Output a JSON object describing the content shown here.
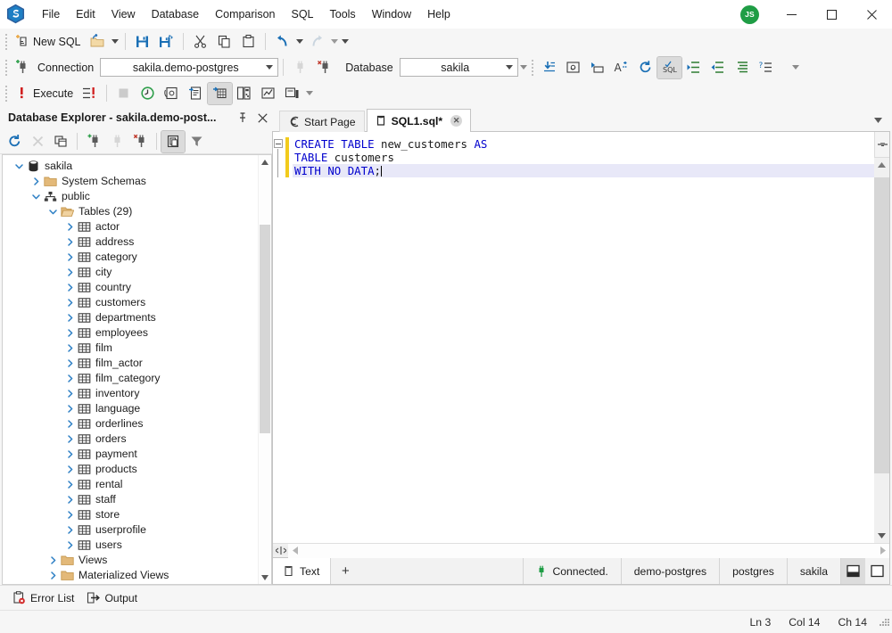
{
  "app": {
    "logo_icon": "sqlmanager-hex-logo",
    "menu": [
      "File",
      "Edit",
      "View",
      "Database",
      "Comparison",
      "SQL",
      "Tools",
      "Window",
      "Help"
    ],
    "avatar_initials": "JS",
    "window_controls": {
      "minimize": "minimize-icon",
      "maximize": "maximize-icon",
      "close": "close-icon"
    }
  },
  "toolbar_main": {
    "new_sql_label": "New SQL",
    "items": [
      {
        "name": "new-sql-button",
        "icon": "new-sql-icon"
      },
      {
        "name": "open-file-button",
        "icon": "open-folder-icon"
      },
      {
        "name": "open-file-dropdown",
        "icon": "chevron-down-icon"
      },
      {
        "name": "save-button",
        "icon": "save-disk-icon"
      },
      {
        "name": "save-all-button",
        "icon": "save-all-icon"
      },
      {
        "name": "cut-button",
        "icon": "scissors-icon"
      },
      {
        "name": "copy-button",
        "icon": "copy-icon"
      },
      {
        "name": "paste-button",
        "icon": "paste-icon"
      },
      {
        "name": "undo-button",
        "icon": "undo-arrow-icon"
      },
      {
        "name": "undo-dropdown",
        "icon": "chevron-down-icon"
      },
      {
        "name": "redo-button",
        "icon": "redo-arrow-icon"
      },
      {
        "name": "redo-dropdown",
        "icon": "chevron-down-icon"
      },
      {
        "name": "toolbar-overflow",
        "icon": "chevron-down-icon"
      }
    ]
  },
  "toolbar_connection": {
    "connect_icon": "connect-plug-icon",
    "connection_label": "Connection",
    "connection_value": "sakila.demo-postgres",
    "disconnect_icon": "plug-grey-icon",
    "disconnect_all_icon": "plug-disconnect-icon",
    "database_label": "Database",
    "database_value": "sakila",
    "overflow_icon": "chevron-down-icon",
    "right_icons": [
      {
        "name": "execute-to-file-button",
        "icon": "insert-down-icon"
      },
      {
        "name": "email-results-button",
        "icon": "at-sign-icon"
      },
      {
        "name": "rename-button",
        "icon": "rename-icon"
      },
      {
        "name": "format-case-button",
        "icon": "letter-a-icon"
      },
      {
        "name": "refresh-button",
        "icon": "refresh-circular-icon"
      },
      {
        "name": "format-sql-button",
        "icon": "sql-check-icon"
      },
      {
        "name": "outdent-button",
        "icon": "outdent-icon"
      },
      {
        "name": "indent-button",
        "icon": "indent-icon"
      },
      {
        "name": "comment-button",
        "icon": "comment-lines-icon"
      },
      {
        "name": "help-sql-button",
        "icon": "question-lines-icon"
      },
      {
        "name": "toolbar-overflow-2",
        "icon": "chevron-down-icon"
      }
    ]
  },
  "toolbar_execute": {
    "execute_label": "Execute",
    "items": [
      {
        "name": "execute-button",
        "icon": "exclamation-red-icon"
      },
      {
        "name": "execute-batch-button",
        "icon": "execute-list-icon"
      },
      {
        "name": "stop-button",
        "icon": "stop-square-icon"
      },
      {
        "name": "execution-plan-button",
        "icon": "clock-green-icon"
      },
      {
        "name": "execute-to-editor-button",
        "icon": "at-page-icon"
      },
      {
        "name": "results-to-text-button",
        "icon": "results-text-icon"
      },
      {
        "name": "results-to-grid-button",
        "icon": "results-grid-icon"
      },
      {
        "name": "results-to-file-button",
        "icon": "results-file-icon"
      },
      {
        "name": "results-to-chart-button",
        "icon": "chart-icon"
      },
      {
        "name": "results-window-button",
        "icon": "results-window-icon"
      },
      {
        "name": "execute-overflow",
        "icon": "chevron-down-icon"
      }
    ]
  },
  "explorer": {
    "title": "Database Explorer - sakila.demo-post...",
    "pin_icon": "pin-icon",
    "close_icon": "close-icon",
    "toolbar": [
      {
        "name": "refresh-button",
        "icon": "refresh-blue-icon"
      },
      {
        "name": "delete-button",
        "icon": "x-grey-icon"
      },
      {
        "name": "duplicate-button",
        "icon": "copy-window-icon"
      },
      {
        "name": "new-connection-button",
        "icon": "plug-add-icon"
      },
      {
        "name": "connect-button",
        "icon": "plug-grey-icon"
      },
      {
        "name": "disconnect-button",
        "icon": "plug-disconnect-icon"
      },
      {
        "name": "copy-object-button",
        "icon": "copy-page-icon"
      },
      {
        "name": "filter-button",
        "icon": "funnel-icon"
      }
    ],
    "tree": [
      {
        "label": "sakila",
        "depth": 0,
        "icon": "database-icon",
        "expander": "down",
        "expanded": true
      },
      {
        "label": "System Schemas",
        "depth": 1,
        "icon": "folder-icon",
        "expander": "right",
        "expanded": false
      },
      {
        "label": "public",
        "depth": 1,
        "icon": "schema-icon",
        "expander": "down",
        "expanded": true
      },
      {
        "label": "Tables (29)",
        "depth": 2,
        "icon": "folder-open-icon",
        "expander": "down",
        "expanded": true
      },
      {
        "label": "actor",
        "depth": 3,
        "icon": "table-icon",
        "expander": "right",
        "expanded": false
      },
      {
        "label": "address",
        "depth": 3,
        "icon": "table-icon",
        "expander": "right",
        "expanded": false
      },
      {
        "label": "category",
        "depth": 3,
        "icon": "table-icon",
        "expander": "right",
        "expanded": false
      },
      {
        "label": "city",
        "depth": 3,
        "icon": "table-icon",
        "expander": "right",
        "expanded": false
      },
      {
        "label": "country",
        "depth": 3,
        "icon": "table-icon",
        "expander": "right",
        "expanded": false
      },
      {
        "label": "customers",
        "depth": 3,
        "icon": "table-icon",
        "expander": "right",
        "expanded": false
      },
      {
        "label": "departments",
        "depth": 3,
        "icon": "table-icon",
        "expander": "right",
        "expanded": false
      },
      {
        "label": "employees",
        "depth": 3,
        "icon": "table-icon",
        "expander": "right",
        "expanded": false
      },
      {
        "label": "film",
        "depth": 3,
        "icon": "table-icon",
        "expander": "right",
        "expanded": false
      },
      {
        "label": "film_actor",
        "depth": 3,
        "icon": "table-icon",
        "expander": "right",
        "expanded": false
      },
      {
        "label": "film_category",
        "depth": 3,
        "icon": "table-icon",
        "expander": "right",
        "expanded": false
      },
      {
        "label": "inventory",
        "depth": 3,
        "icon": "table-icon",
        "expander": "right",
        "expanded": false
      },
      {
        "label": "language",
        "depth": 3,
        "icon": "table-icon",
        "expander": "right",
        "expanded": false
      },
      {
        "label": "orderlines",
        "depth": 3,
        "icon": "table-icon",
        "expander": "right",
        "expanded": false
      },
      {
        "label": "orders",
        "depth": 3,
        "icon": "table-icon",
        "expander": "right",
        "expanded": false
      },
      {
        "label": "payment",
        "depth": 3,
        "icon": "table-icon",
        "expander": "right",
        "expanded": false
      },
      {
        "label": "products",
        "depth": 3,
        "icon": "table-icon",
        "expander": "right",
        "expanded": false
      },
      {
        "label": "rental",
        "depth": 3,
        "icon": "table-icon",
        "expander": "right",
        "expanded": false
      },
      {
        "label": "staff",
        "depth": 3,
        "icon": "table-icon",
        "expander": "right",
        "expanded": false
      },
      {
        "label": "store",
        "depth": 3,
        "icon": "table-icon",
        "expander": "right",
        "expanded": false
      },
      {
        "label": "userprofile",
        "depth": 3,
        "icon": "table-icon",
        "expander": "right",
        "expanded": false
      },
      {
        "label": "users",
        "depth": 3,
        "icon": "table-icon",
        "expander": "right",
        "expanded": false
      },
      {
        "label": "Views",
        "depth": 2,
        "icon": "folder-icon",
        "expander": "right",
        "expanded": false
      },
      {
        "label": "Materialized Views",
        "depth": 2,
        "icon": "folder-icon",
        "expander": "right",
        "expanded": false
      }
    ]
  },
  "editor": {
    "tabs": [
      {
        "label": "Start Page",
        "icon": "start-page-icon",
        "active": false,
        "closable": false
      },
      {
        "label": "SQL1.sql*",
        "icon": "sql-file-icon",
        "active": true,
        "closable": true
      }
    ],
    "tab_overflow_icon": "chevron-down-icon",
    "split_view_icon": "split-view-icon",
    "code_lines": [
      {
        "tokens": [
          {
            "t": "CREATE",
            "k": "kw"
          },
          {
            "t": " ",
            "k": "idn"
          },
          {
            "t": "TABLE",
            "k": "kw"
          },
          {
            "t": " new_customers ",
            "k": "idn"
          },
          {
            "t": "AS",
            "k": "kw"
          }
        ],
        "current": false
      },
      {
        "tokens": [
          {
            "t": "TABLE",
            "k": "kw"
          },
          {
            "t": " customers",
            "k": "idn"
          }
        ],
        "current": false
      },
      {
        "tokens": [
          {
            "t": "WITH",
            "k": "kw"
          },
          {
            "t": " ",
            "k": "idn"
          },
          {
            "t": "NO",
            "k": "kw"
          },
          {
            "t": " ",
            "k": "idn"
          },
          {
            "t": "DATA",
            "k": "kw"
          },
          {
            "t": ";",
            "k": "idn"
          }
        ],
        "current": true
      }
    ]
  },
  "results": {
    "tab_label": "Text",
    "tab_icon": "sql-file-icon",
    "add_tab_label": "+",
    "connected_label": "Connected.",
    "connected_icon": "plug-green-icon",
    "server": "demo-postgres",
    "user": "postgres",
    "database": "sakila",
    "layout_split_icon": "layout-split-icon",
    "layout_full_icon": "layout-full-icon"
  },
  "bottom_dock": {
    "tabs": [
      {
        "label": "Error List",
        "icon": "error-list-icon"
      },
      {
        "label": "Output",
        "icon": "output-arrow-icon"
      }
    ]
  },
  "statusbar": {
    "line": "Ln 3",
    "column": "Col 14",
    "char": "Ch 14"
  },
  "colors": {
    "accent_blue": "#0072c6",
    "keyword_blue": "#0000cd",
    "connected_green": "#1f9d45",
    "change_bar_yellow": "#f2cb1c",
    "error_red": "#d02020"
  }
}
